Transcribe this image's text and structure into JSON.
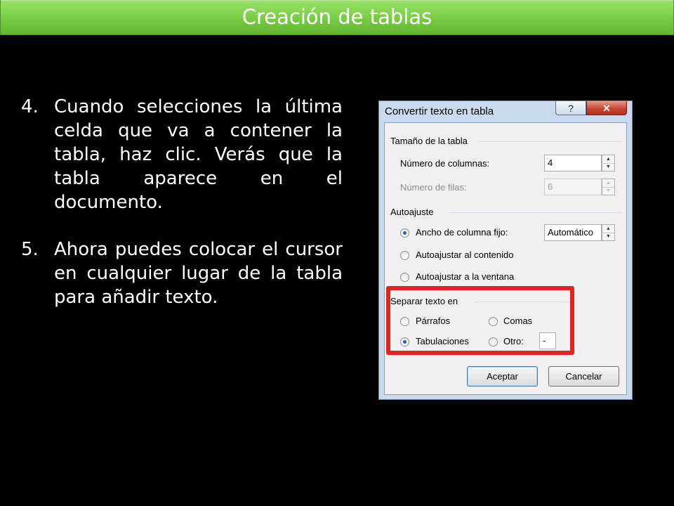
{
  "header": {
    "title": "Creación de tablas"
  },
  "steps": [
    {
      "number": "4.",
      "text": "Cuando selecciones la última celda que va a contener la tabla, haz clic. Verás que la tabla aparece en el documento."
    },
    {
      "number": "5.",
      "text": "Ahora puedes colocar el cursor en cualquier lugar de la tabla para añadir texto."
    }
  ],
  "dialog": {
    "title": "Convertir texto en tabla",
    "help_icon": "question-mark-icon",
    "close_icon": "close-x-icon",
    "table_size": {
      "title": "Tamaño de la tabla",
      "columns_label": "Número de columnas:",
      "columns_value": "4",
      "rows_label": "Número de filas:",
      "rows_value": "6"
    },
    "autofit": {
      "title": "Autoajuste",
      "fixed_label": "Ancho de columna fijo:",
      "fixed_value": "Automático",
      "content_label": "Autoajustar al contenido",
      "window_label": "Autoajustar a la ventana",
      "selected": "fixed"
    },
    "separator": {
      "title": "Separar texto en",
      "paragraphs_label": "Párrafos",
      "commas_label": "Comas",
      "tabs_label": "Tabulaciones",
      "other_label": "Otro:",
      "other_value": "-",
      "selected": "tabs"
    },
    "buttons": {
      "ok": "Aceptar",
      "cancel": "Cancelar"
    },
    "highlight_color": "#e02323"
  }
}
